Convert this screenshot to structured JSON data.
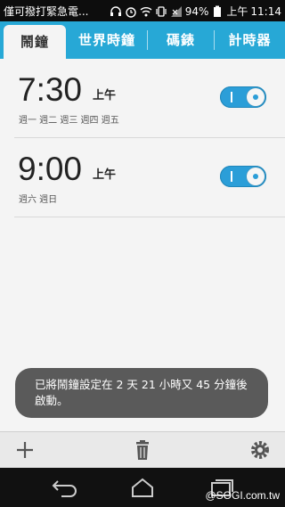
{
  "status_bar": {
    "carrier_text": "僅可撥打緊急電...",
    "battery": "94%",
    "time_ampm": "上午",
    "time": "11:14"
  },
  "tabs": [
    {
      "label": "鬧鐘",
      "active": true
    },
    {
      "label": "世界時鐘",
      "active": false
    },
    {
      "label": "碼錶",
      "active": false
    },
    {
      "label": "計時器",
      "active": false
    }
  ],
  "alarms": [
    {
      "time": "7:30",
      "ampm": "上午",
      "days": "週一 週二 週三 週四 週五",
      "enabled": true
    },
    {
      "time": "9:00",
      "ampm": "上午",
      "days": "週六 週日",
      "enabled": true
    }
  ],
  "toast": {
    "message": "已將鬧鐘設定在 2 天 21 小時又 45 分鐘後啟動。"
  },
  "toolbar": {
    "add_icon": "plus-icon",
    "delete_icon": "trash-icon",
    "settings_icon": "gear-icon"
  },
  "navbar": {
    "watermark": "@SOGI.com.tw"
  },
  "colors": {
    "accent": "#27a8d6",
    "toggle_on": "#2b9ed8",
    "toast_bg": "#5a5a5a"
  }
}
